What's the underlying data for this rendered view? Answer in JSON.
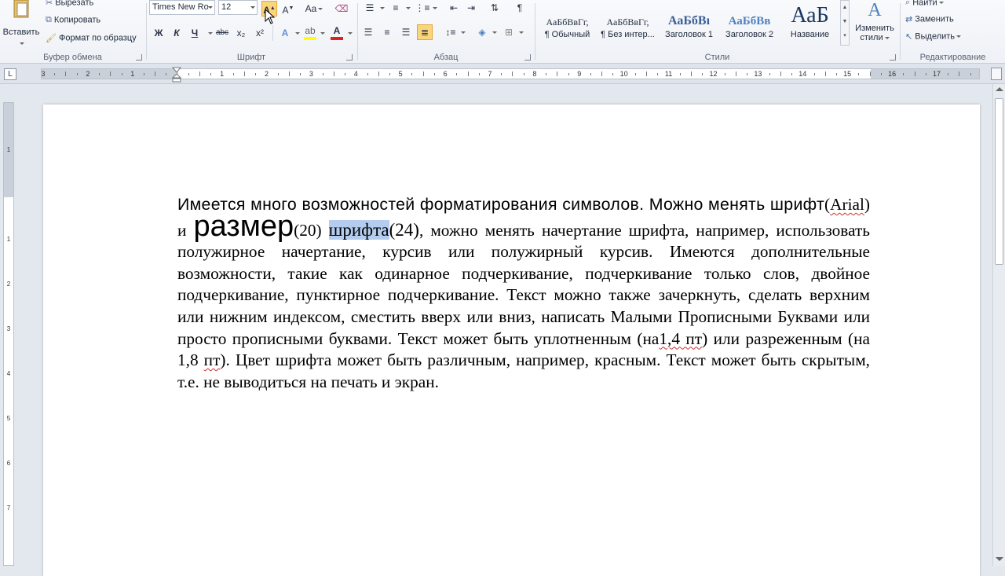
{
  "clipboard": {
    "paste_label": "Вставить",
    "cut_label": "Вырезать",
    "copy_label": "Копировать",
    "format_painter_label": "Формат по образцу",
    "group_label": "Буфер обмена"
  },
  "font": {
    "family_value": "Times New Ro",
    "size_value": "12",
    "grow_icon": "grow-font-icon",
    "shrink_icon": "shrink-font-icon",
    "case_label": "Aa",
    "bold_label": "Ж",
    "italic_label": "К",
    "underline_label": "Ч",
    "strike_label": "abc",
    "sub_label": "x₂",
    "sup_label": "x²",
    "text_color": "#e02020",
    "highlight_color": "#ffff00",
    "group_label": "Шрифт"
  },
  "paragraph": {
    "group_label": "Абзац",
    "show_marks_label": "¶"
  },
  "styles": {
    "group_label": "Стили",
    "change_styles_label_1": "Изменить",
    "change_styles_label_2": "стили",
    "items": [
      {
        "sample": "АаБбВвГг,",
        "name": "¶ Обычный"
      },
      {
        "sample": "АаБбВвГг,",
        "name": "¶ Без интер..."
      },
      {
        "sample": "АаБбВı",
        "name": "Заголовок 1"
      },
      {
        "sample": "АаБбВв",
        "name": "Заголовок 2"
      },
      {
        "sample": "АаБ",
        "name": "Название"
      }
    ]
  },
  "editing": {
    "group_label": "Редактирование",
    "find_label": "Найти",
    "replace_label": "Заменить",
    "select_label": "Выделить"
  },
  "ruler": {
    "tab_selector": "L",
    "numbers": [
      "3",
      "2",
      "1",
      "",
      "1",
      "2",
      "3",
      "4",
      "5",
      "6",
      "7",
      "8",
      "9",
      "10",
      "11",
      "12",
      "13",
      "14",
      "15",
      "16",
      "17"
    ]
  },
  "vruler": {
    "numbers": [
      "1",
      "",
      "1",
      "2",
      "3",
      "4",
      "5",
      "6",
      "7"
    ]
  },
  "document": {
    "p1_a": "Имеется много возможностей форматирования символов. Можно менять шрифт",
    "p1_b": "(",
    "p1_arial": "Arial",
    "p1_c": ") и ",
    "p1_size_word": "размер",
    "p1_size_note": "(20)",
    "p1_d": " ",
    "p1_selected": "шрифта",
    "p1_size_note2": "(24)",
    "p1_e": ", можно менять начертание шрифта, например, использовать полужирное начертание, курсив или полужирный курсив. Имеются дополнительные возможности, такие как одинарное подчеркивание, подчеркивание только слов, двойное подчеркивание, пунктирное подчеркивание. Текст можно также зачеркнуть, сделать верхним или нижним индексом, сместить вверх или вниз, написать Малыми Прописными Буквами или просто прописными буквами. Текст может быть уплотненным (на",
    "p1_f": "1,4 пт",
    "p1_g": ") или разреженным (на 1,8 ",
    "p1_h": "пт",
    "p1_i": "). Цвет шрифта может быть различным, например, красным. Текст может быть скрытым, т.е. не выводиться на печать и экран."
  }
}
